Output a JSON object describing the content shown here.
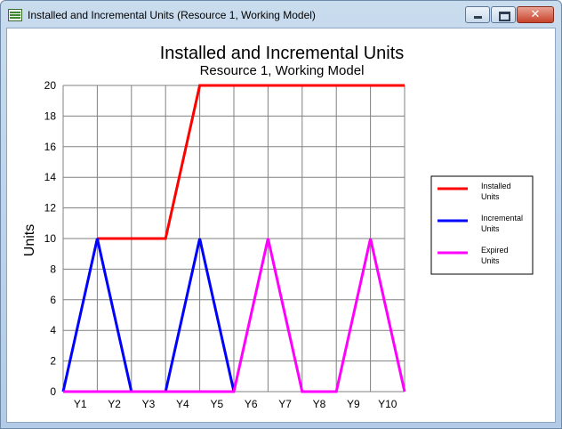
{
  "window": {
    "title": "Installed and Incremental Units (Resource 1, Working Model)",
    "controls": {
      "minimize": "minimize",
      "maximize": "maximize",
      "close": "✕"
    }
  },
  "chart_data": {
    "type": "line",
    "title": "Installed and Incremental Units",
    "subtitle": "Resource 1, Working Model",
    "xlabel": "",
    "ylabel": "Units",
    "categories": [
      "Y1",
      "Y2",
      "Y3",
      "Y4",
      "Y5",
      "Y6",
      "Y7",
      "Y8",
      "Y9",
      "Y10"
    ],
    "x_boundaries": [
      0,
      1,
      2,
      3,
      4,
      5,
      6,
      7,
      8,
      9,
      10
    ],
    "ylim": [
      0,
      20
    ],
    "yticks": [
      0,
      2,
      4,
      6,
      8,
      10,
      12,
      14,
      16,
      18,
      20
    ],
    "grid": true,
    "legend_position": "right",
    "series": [
      {
        "name": "Installed Units",
        "color": "#ff0000",
        "x": [
          1,
          2,
          3,
          4,
          10
        ],
        "y": [
          10,
          10,
          10,
          20,
          20
        ]
      },
      {
        "name": "Incremental Units",
        "color": "#0000ff",
        "x": [
          0,
          1,
          2,
          3,
          4,
          5
        ],
        "y": [
          0,
          10,
          0,
          0,
          10,
          0
        ]
      },
      {
        "name": "Expired Units",
        "color": "#ff00ff",
        "x": [
          0,
          5,
          6,
          7,
          8,
          9,
          10
        ],
        "y": [
          0,
          0,
          10,
          0,
          0,
          10,
          0
        ]
      }
    ]
  }
}
